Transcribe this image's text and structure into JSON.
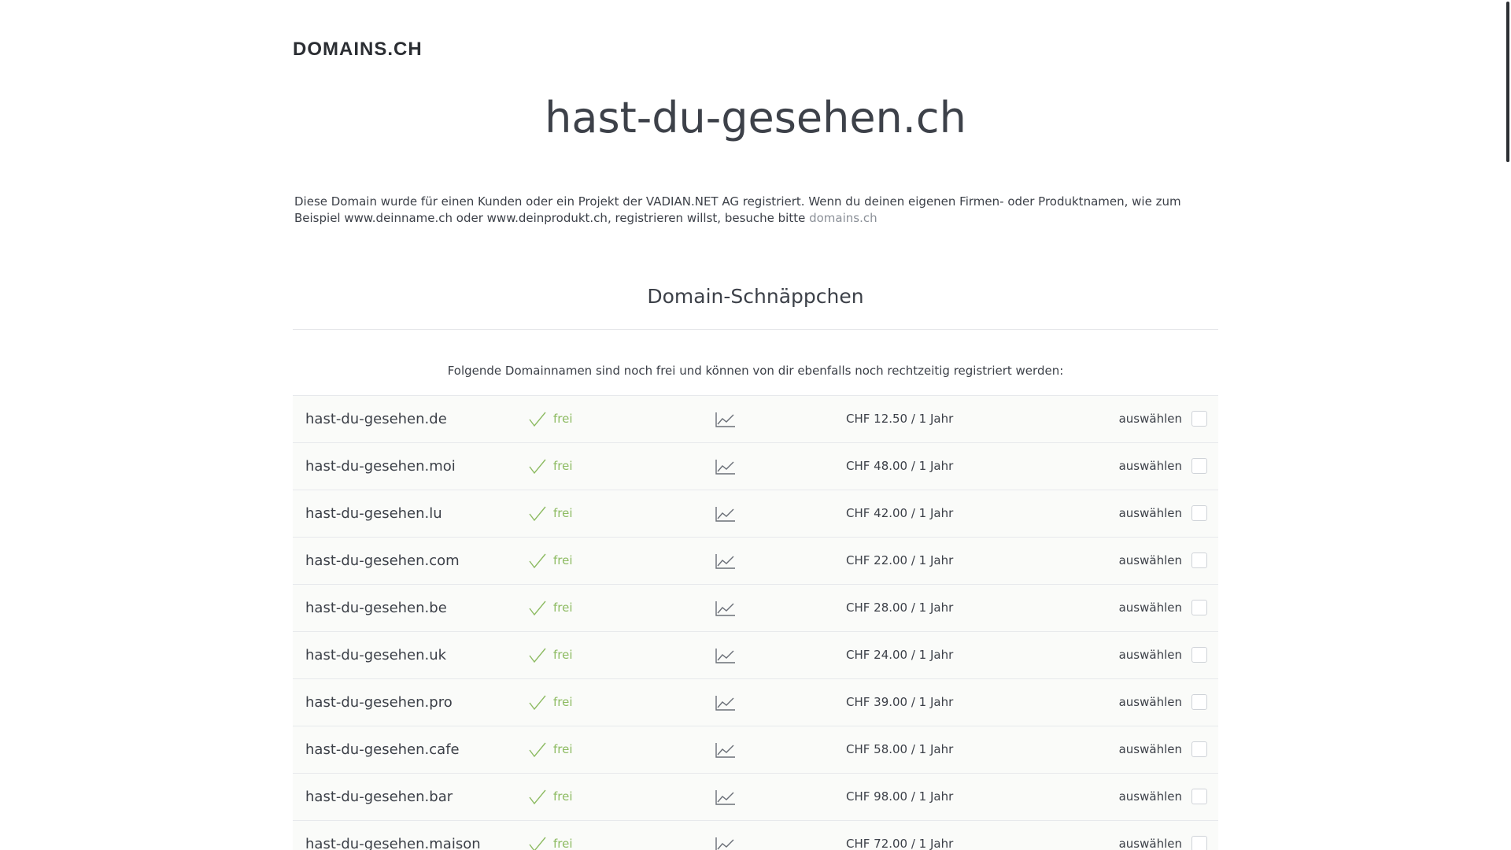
{
  "header": {
    "logo": "DOMAINS.CH",
    "domain_title": "hast-du-gesehen.ch"
  },
  "intro": {
    "text": "Diese Domain wurde für einen Kunden oder ein Projekt der VADIAN.NET AG registriert. Wenn du deinen eigenen Firmen- oder Produktnamen, wie zum Beispiel www.deinname.ch oder www.deinprodukt.ch, registrieren willst, besuche bitte ",
    "link": "domains.ch"
  },
  "section": {
    "title": "Domain-Schnäppchen",
    "subtitle": "Folgende Domainnamen sind noch frei und können von dir ebenfalls noch rechtzeitig registriert werden:"
  },
  "icons": {
    "status": "checkmark-icon",
    "stats": "line-chart-icon"
  },
  "colors": {
    "status_green": "#8dbb62",
    "row_background": "#fafbf9"
  },
  "domains": [
    {
      "name": "hast-du-gesehen.de",
      "status": "frei",
      "price": "CHF 12.50 / 1 Jahr",
      "select_label": "auswählen"
    },
    {
      "name": "hast-du-gesehen.moi",
      "status": "frei",
      "price": "CHF 48.00 / 1 Jahr",
      "select_label": "auswählen"
    },
    {
      "name": "hast-du-gesehen.lu",
      "status": "frei",
      "price": "CHF 42.00 / 1 Jahr",
      "select_label": "auswählen"
    },
    {
      "name": "hast-du-gesehen.com",
      "status": "frei",
      "price": "CHF 22.00 / 1 Jahr",
      "select_label": "auswählen"
    },
    {
      "name": "hast-du-gesehen.be",
      "status": "frei",
      "price": "CHF 28.00 / 1 Jahr",
      "select_label": "auswählen"
    },
    {
      "name": "hast-du-gesehen.uk",
      "status": "frei",
      "price": "CHF 24.00 / 1 Jahr",
      "select_label": "auswählen"
    },
    {
      "name": "hast-du-gesehen.pro",
      "status": "frei",
      "price": "CHF 39.00 / 1 Jahr",
      "select_label": "auswählen"
    },
    {
      "name": "hast-du-gesehen.cafe",
      "status": "frei",
      "price": "CHF 58.00 / 1 Jahr",
      "select_label": "auswählen"
    },
    {
      "name": "hast-du-gesehen.bar",
      "status": "frei",
      "price": "CHF 98.00 / 1 Jahr",
      "select_label": "auswählen"
    },
    {
      "name": "hast-du-gesehen.maison",
      "status": "frei",
      "price": "CHF 72.00 / 1 Jahr",
      "select_label": "auswählen"
    }
  ]
}
